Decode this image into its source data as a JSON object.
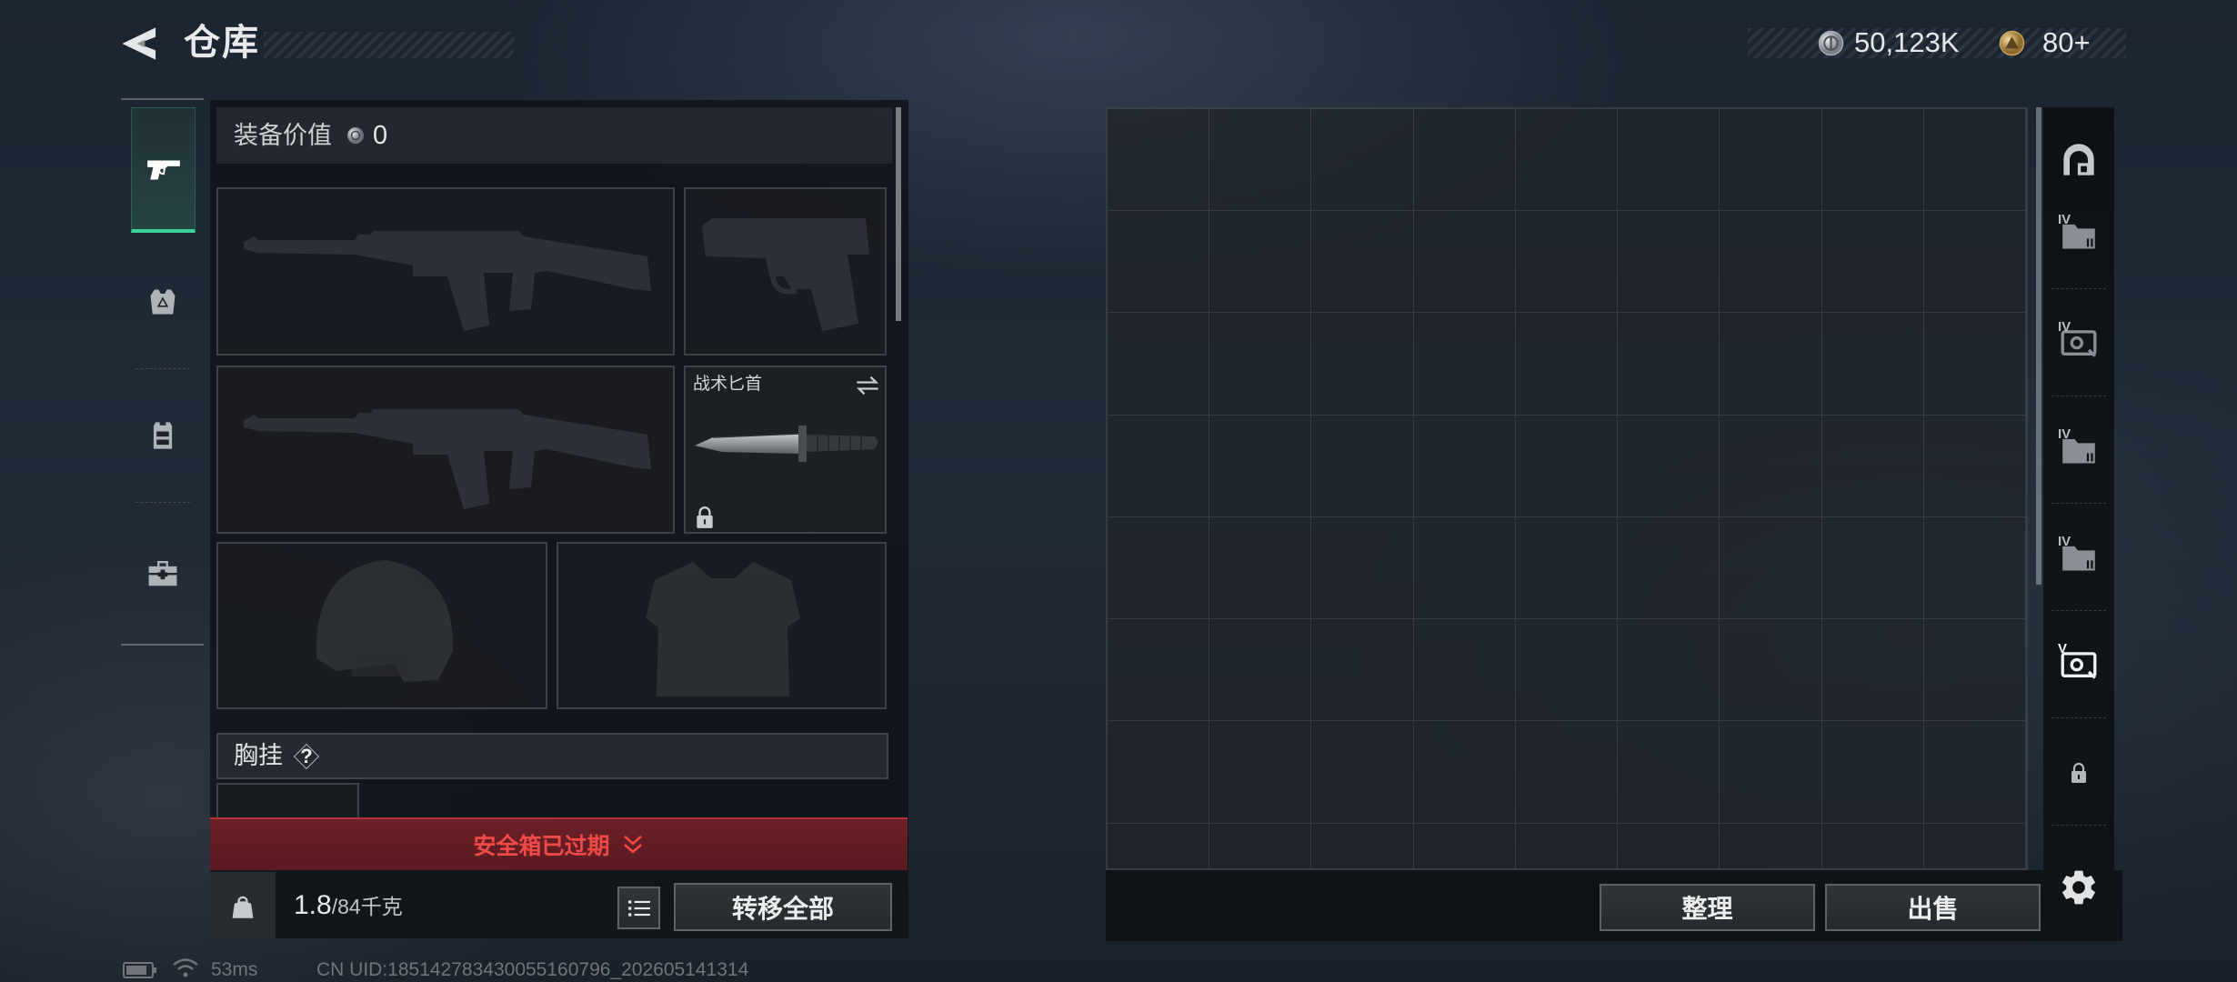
{
  "header": {
    "title": "仓库"
  },
  "currency": {
    "silver_icon": "silver-coin-icon",
    "silver": "50,123K",
    "gold_icon": "gold-coin-icon",
    "gold": "80+"
  },
  "sidebar": {
    "tabs": [
      {
        "icon": "pistol-icon",
        "active": true
      },
      {
        "icon": "armor-icon",
        "active": false
      },
      {
        "icon": "chest-rig-icon",
        "active": false
      },
      {
        "icon": "toolbox-icon",
        "active": false
      }
    ]
  },
  "equipment": {
    "value_label": "装备价值",
    "value": "0",
    "melee_label": "战术匕首",
    "chest_rig_label": "胸挂",
    "chest_rig_help": "?"
  },
  "safe_box": {
    "status": "安全箱已过期"
  },
  "capacity": {
    "current": "1.8",
    "max": "/84千克"
  },
  "actions": {
    "transfer_all": "转移全部",
    "sort": "整理",
    "sell": "出售"
  },
  "container_tabs": [
    {
      "icon": "shelter-icon"
    },
    {
      "icon": "case-icon",
      "tier": "IV"
    },
    {
      "icon": "safe-icon",
      "tier": "IV"
    },
    {
      "icon": "case-icon",
      "tier": "IV"
    },
    {
      "icon": "case-icon",
      "tier": "IV"
    },
    {
      "icon": "safe-icon",
      "tier": "V",
      "active": true
    },
    {
      "icon": "lock-icon",
      "locked": true
    }
  ],
  "status_bar": {
    "ping": "53ms",
    "uid": "CN UID:185142783430055160796_202605141314"
  },
  "colors": {
    "accent": "#3bd19a",
    "danger": "#ef4a48",
    "danger_bg": "#5a1b21"
  }
}
